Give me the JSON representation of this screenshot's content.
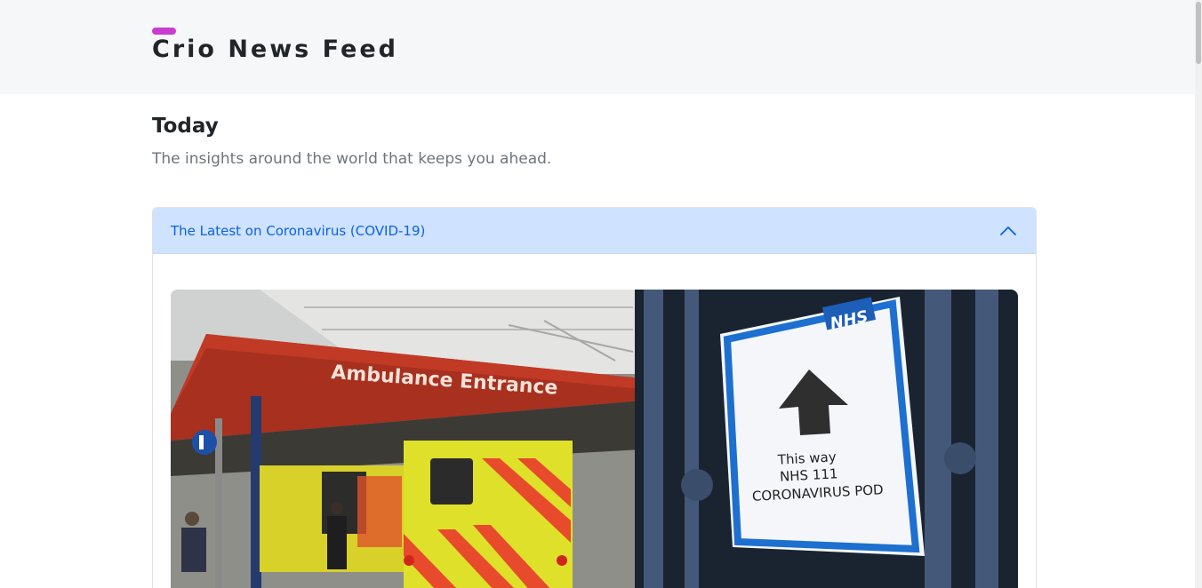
{
  "header": {
    "brand_title": "Crio News Feed",
    "accent_color": "#c93ccf"
  },
  "intro": {
    "heading": "Today",
    "subtitle": "The insights around the world that keeps you ahead."
  },
  "accordion": {
    "title": "The Latest on Coronavirus (COVID-19)",
    "expanded": true,
    "header_color": "#cfe2ff",
    "title_color": "#0c63e4",
    "toggle_icon": "chevron-up-icon"
  },
  "article_image": {
    "sign_text": "Ambulance Entrance",
    "poster_brand": "NHS",
    "poster_line1": "This way",
    "poster_line2": "NHS 111",
    "poster_line3": "CORONAVIRUS POD"
  }
}
